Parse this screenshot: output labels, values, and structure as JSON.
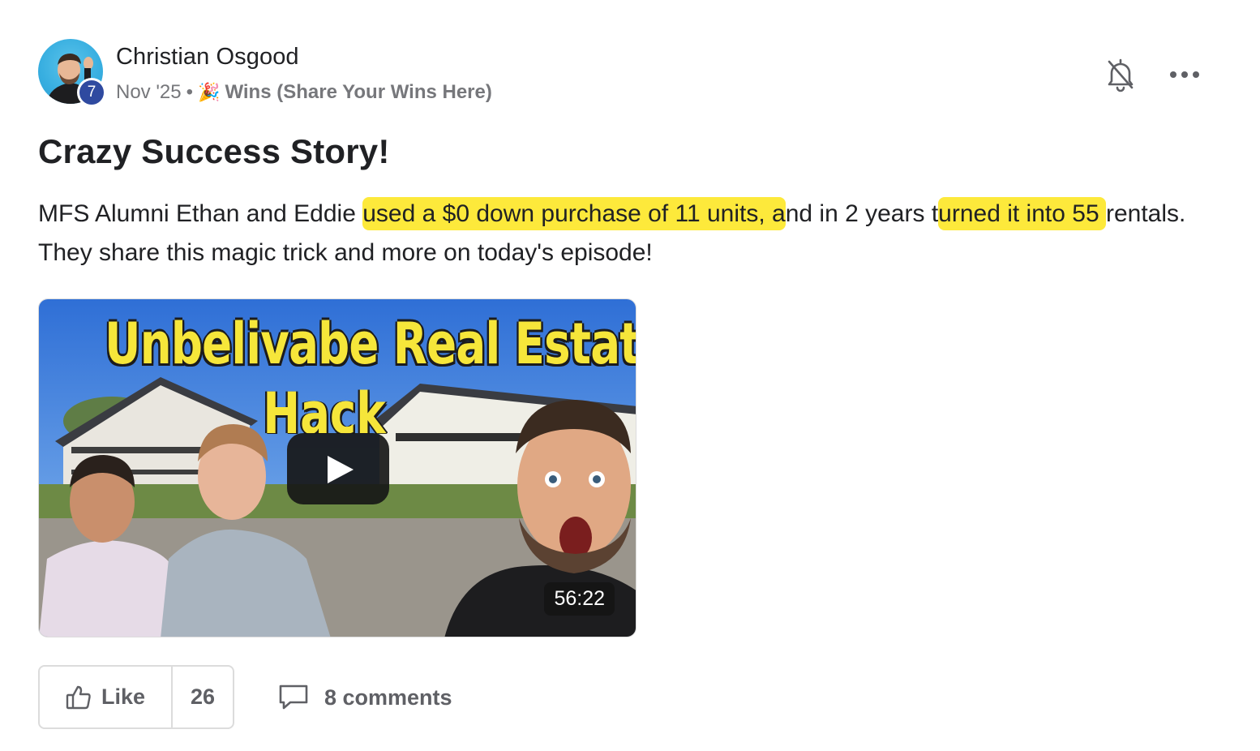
{
  "post": {
    "author": {
      "name": "Christian Osgood",
      "level": "7"
    },
    "date": "Nov '25",
    "separator": "•",
    "category": {
      "emoji": "🎉",
      "label": "Wins (Share Your Wins Here)"
    },
    "title": "Crazy Success Story!",
    "body": {
      "segments": [
        "MFS Alumni Ethan and Eddie ",
        "used a $0 down purchase of 11 units, a",
        "nd in 2 years t",
        "urned it into 55  ",
        " rentals. They share this magic trick and more on today's episode!"
      ]
    },
    "video": {
      "thumbnail_title_line1": "Unbelivabe Real Estate",
      "thumbnail_title_line2": "Hack",
      "duration": "56:22"
    },
    "actions": {
      "like_label": "Like",
      "like_count": "26",
      "comments_label": "8 comments"
    },
    "icons": {
      "bell": "bell-muted-icon",
      "more": "more-horizontal-icon",
      "like": "thumbs-up-icon",
      "comment": "comment-bubble-icon",
      "play": "play-icon"
    },
    "colors": {
      "highlight": "#fde93b",
      "level_badge": "#2f4aa0",
      "thumbnail_text": "#f6e63a"
    }
  }
}
